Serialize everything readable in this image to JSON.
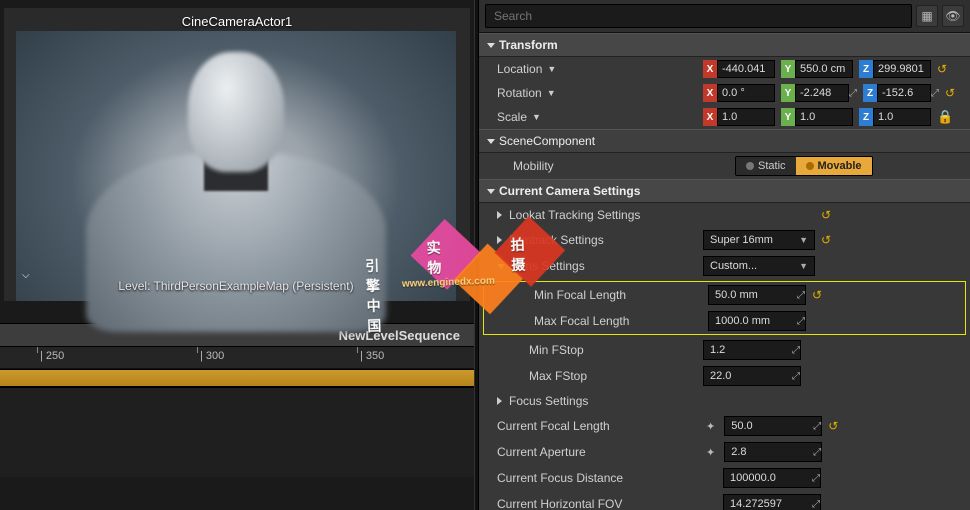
{
  "viewport": {
    "title": "CineCameraActor1",
    "level_label": "Level:  ThirdPersonExampleMap (Persistent)"
  },
  "sequencer": {
    "title": "NewLevelSequence",
    "ticks": [
      "| 250",
      "| 300",
      "| 350"
    ]
  },
  "search": {
    "placeholder": "Search"
  },
  "sections": {
    "transform": "Transform",
    "scenecomponent": "SceneComponent",
    "camera": "Current Camera Settings"
  },
  "transform": {
    "location_label": "Location",
    "rotation_label": "Rotation",
    "scale_label": "Scale",
    "loc": {
      "x": "-440.041",
      "y": "550.0 cm",
      "z": "299.9801"
    },
    "rot": {
      "x": "0.0 °",
      "y": "-2.248",
      "z": "-152.6"
    },
    "scl": {
      "x": "1.0",
      "y": "1.0",
      "z": "1.0"
    }
  },
  "mobility": {
    "label": "Mobility",
    "static": "Static",
    "movable": "Movable"
  },
  "camera": {
    "lookat": "Lookat Tracking Settings",
    "filmback": "Filmback Settings",
    "filmback_value": "Super 16mm",
    "lens": "Lens Settings",
    "lens_value": "Custom...",
    "min_focal": "Min Focal Length",
    "min_focal_value": "50.0 mm",
    "max_focal": "Max Focal Length",
    "max_focal_value": "1000.0 mm",
    "min_fstop": "Min FStop",
    "min_fstop_value": "1.2",
    "max_fstop": "Max FStop",
    "max_fstop_value": "22.0",
    "focus": "Focus Settings",
    "cfl": "Current Focal Length",
    "cfl_value": "50.0",
    "cap": "Current Aperture",
    "cap_value": "2.8",
    "cfd": "Current Focus Distance",
    "cfd_value": "100000.0",
    "fov": "Current Horizontal FOV",
    "fov_value": "14.272597"
  },
  "watermark": {
    "brand": "引擎中国",
    "t1": "实 物",
    "t2": "拍 摄",
    "url": "www.enginedx.com"
  }
}
